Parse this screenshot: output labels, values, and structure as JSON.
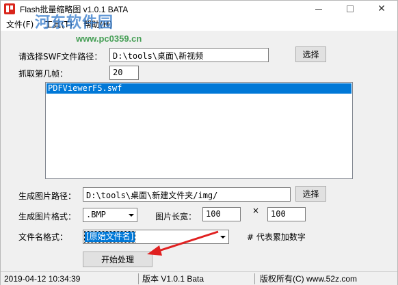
{
  "window": {
    "title": "Flash批量缩略图 v1.0.1 BATA",
    "minimize_icon": "minimize-icon",
    "maximize_icon": "maximize-icon",
    "close_icon": "close-icon"
  },
  "watermark": {
    "logo_text": "河东软件园",
    "url": "www.pc0359.cn"
  },
  "menu": {
    "items": [
      {
        "label": "文件(F)"
      },
      {
        "label": "工具(T)"
      },
      {
        "label": "帮助(H)"
      }
    ]
  },
  "form": {
    "swf_path_label": "请选择SWF文件路径：",
    "swf_path_value": "D:\\tools\\桌面\\新视频",
    "swf_select_button": "选择",
    "frame_label": "抓取第几帧：",
    "frame_value": "20",
    "file_list": [
      "PDFViewerFS.swf"
    ],
    "output_path_label": "生成图片路径：",
    "output_path_value": "D:\\tools\\桌面\\新建文件夹/img/",
    "output_select_button": "选择",
    "format_label": "生成图片格式：",
    "format_value": ".BMP",
    "size_label": "图片长宽：",
    "width_value": "100",
    "times_symbol": "×",
    "height_value": "100",
    "filename_label": "文件名格式：",
    "filename_value": "[原始文件名]",
    "filename_hint": "# 代表累加数字",
    "start_button": "开始处理"
  },
  "annotation": {
    "arrow_color": "#e02020"
  },
  "status": {
    "datetime": "2019-04-12 10:34:39",
    "version": "版本 V1.0.1 Bata",
    "copyright": "版权所有(C) www.52z.com"
  },
  "colors": {
    "selection": "#0078d7",
    "watermark_blue": "#2e76c9",
    "watermark_green": "#1a8a2e"
  }
}
